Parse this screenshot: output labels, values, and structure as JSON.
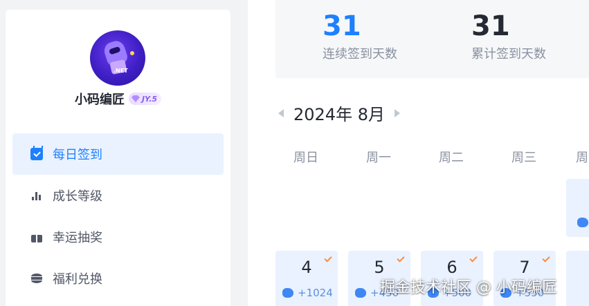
{
  "profile": {
    "username": "小码编匠",
    "level_badge": "JY.5",
    "avatar_text": ".NET"
  },
  "sidebar": {
    "items": [
      {
        "label": "每日签到",
        "icon": "calendar-check-icon",
        "active": true
      },
      {
        "label": "成长等级",
        "icon": "bar-chart-icon",
        "active": false
      },
      {
        "label": "幸运抽奖",
        "icon": "gift-icon",
        "active": false
      },
      {
        "label": "福利兑换",
        "icon": "coin-stack-icon",
        "active": false
      }
    ]
  },
  "stats": {
    "consecutive": {
      "value": "31",
      "label": "连续签到天数"
    },
    "total": {
      "value": "31",
      "label": "累计签到天数"
    }
  },
  "calendar": {
    "month_label": "2024年 8月",
    "weekdays": [
      "周日",
      "周一",
      "周二",
      "周三",
      "周"
    ],
    "days": [
      {
        "day": "4",
        "points": "+1024",
        "checked": true
      },
      {
        "day": "5",
        "points": "+450",
        "checked": true
      },
      {
        "day": "6",
        "points": "+500",
        "checked": true
      },
      {
        "day": "7",
        "points": "+550",
        "checked": true
      }
    ]
  },
  "watermark": "掘金技术社区 @ 小码编匠",
  "colors": {
    "accent": "#1e80ff",
    "check": "#ff8a3d",
    "badge": "#8a5cf6"
  }
}
